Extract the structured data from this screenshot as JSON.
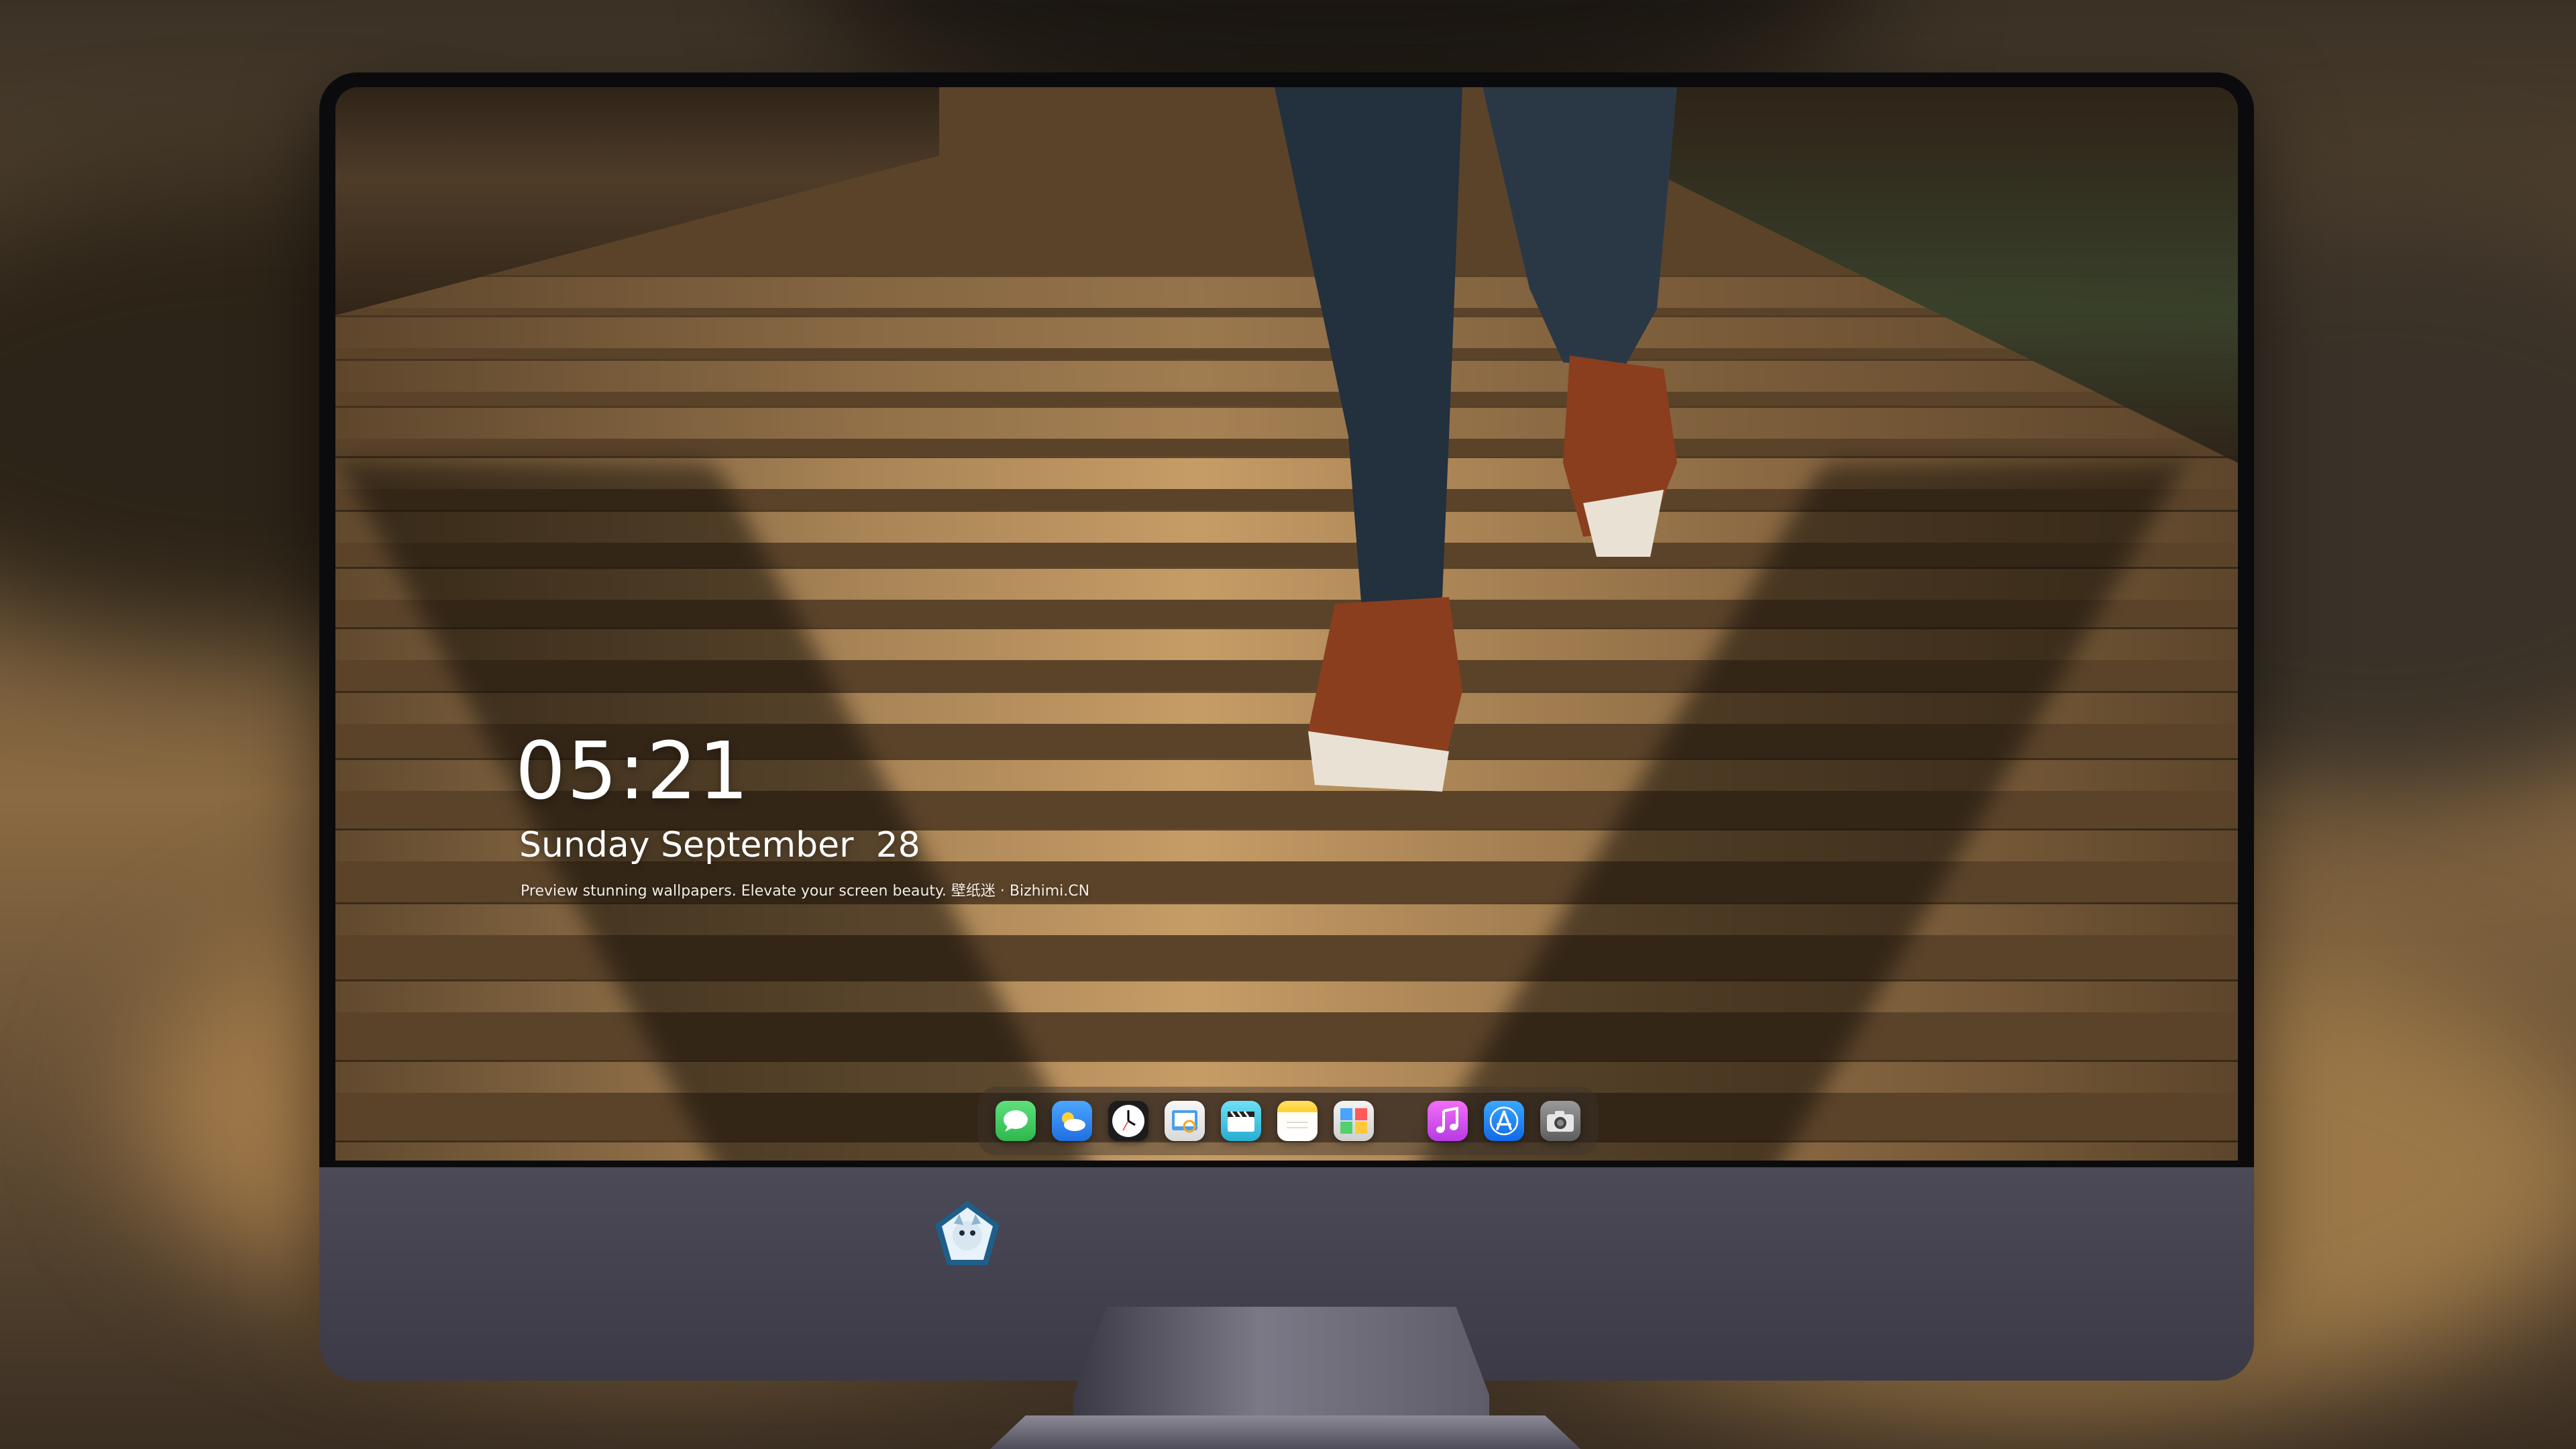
{
  "lockscreen": {
    "time": "05:21",
    "date": "Sunday September  28",
    "tagline": "Preview stunning wallpapers. Elevate your screen beauty. 壁纸迷 · Bizhimi.CN"
  },
  "dock": {
    "apps": [
      {
        "name": "messages-icon",
        "color": "#34c759"
      },
      {
        "name": "weather-icon",
        "color": "#2f8df3"
      },
      {
        "name": "clock-icon",
        "color": "#ffffff"
      },
      {
        "name": "preview-icon",
        "color": "#f2f2f2"
      },
      {
        "name": "clips-icon",
        "color": "#3ec6e6"
      },
      {
        "name": "notes-icon",
        "color": "#ffd94a"
      },
      {
        "name": "photo-booth-icon",
        "color": "#e9e9e9"
      },
      {
        "name": "music-icon",
        "color": "#d94af0"
      },
      {
        "name": "app-store-icon",
        "color": "#1e8bf5"
      },
      {
        "name": "camera-icon",
        "color": "#7d7d7d"
      }
    ]
  },
  "colors": {
    "monitor_bezel": "#0b0b0d",
    "chin": "#434250",
    "text": "#ffffff"
  }
}
